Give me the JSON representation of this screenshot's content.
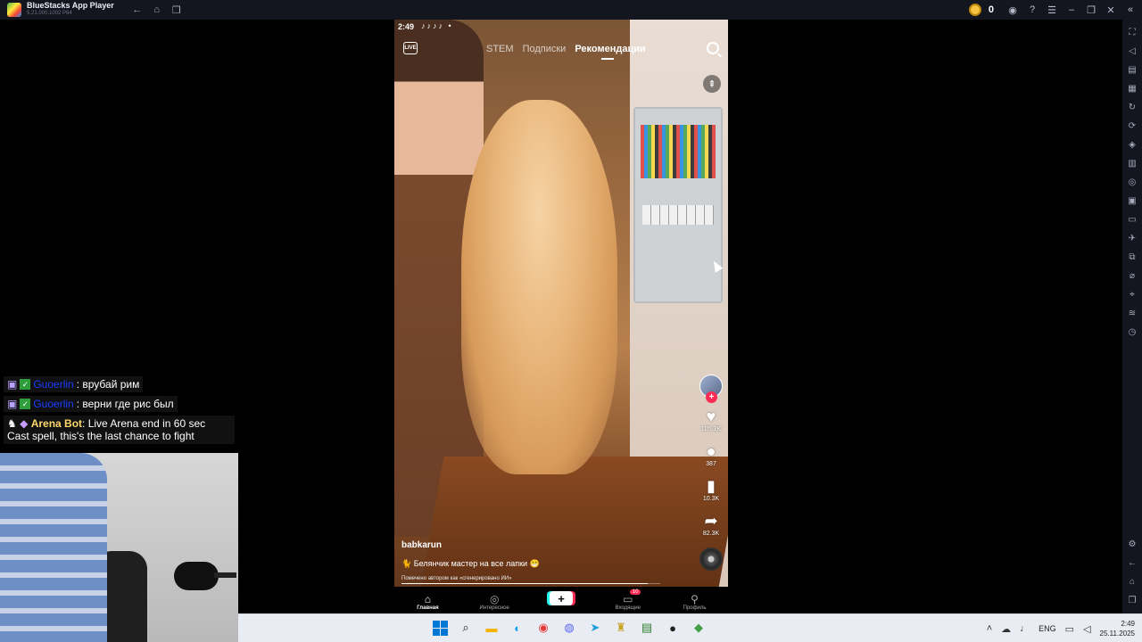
{
  "window": {
    "app_name": "BlueStacks App Player",
    "version": "5.21.000.1002 P64",
    "coins": "0"
  },
  "phone": {
    "status_time": "2:49",
    "status_icons": "♪♪♪♪ •",
    "tabs": [
      "STEM",
      "Подписки",
      "Рекомендации"
    ],
    "active_tab": "Рекомендации",
    "username": "babkarun",
    "description": "🐈 Белянчик мастер на все лапки 😁",
    "ai_label": "Помечено автором как «сгенерировано ИИ»",
    "progress": 0.95,
    "actions": {
      "likes": "105.3K",
      "comments": "387",
      "saves": "10.3K",
      "shares": "82.3K"
    },
    "bottom_nav": [
      {
        "label": "Главная",
        "icon": "home-icon",
        "active": true
      },
      {
        "label": "Интересное",
        "icon": "compass-icon",
        "active": false
      },
      {
        "label": "",
        "icon": "create-icon",
        "active": false
      },
      {
        "label": "Входящие",
        "icon": "inbox-icon",
        "active": false,
        "badge": "10"
      },
      {
        "label": "Профиль",
        "icon": "profile-icon",
        "active": false
      }
    ]
  },
  "chat": {
    "line1_nick": "Guoerlin",
    "line1_text": ": врубай рим",
    "line2_nick": "Guoerlin",
    "line2_text": ": верни где рис был",
    "bot_name": "Arena Bot",
    "bot_text1": ": Live Arena end in 60 sec",
    "bot_text2": "Cast spell, this's the last chance to fight"
  },
  "taskbar": {
    "lang": "ENG",
    "time": "2:49",
    "date": "25.11.2025"
  },
  "colors": {
    "titlebar": "#14161f",
    "accent_pink": "#fe2c55",
    "accent_cyan": "#25f4ee"
  }
}
